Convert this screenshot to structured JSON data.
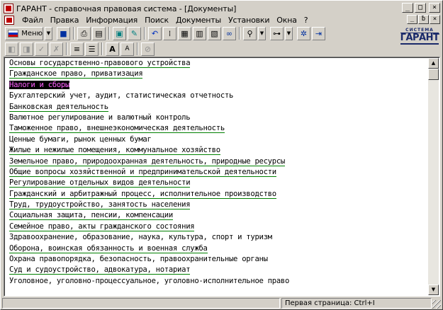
{
  "window": {
    "title": "ГАРАНТ - справочная правовая система - [Документы]",
    "caption_buttons": [
      "_",
      "□",
      "×"
    ]
  },
  "menubar": {
    "items": [
      "Файл",
      "Правка",
      "Информация",
      "Поиск",
      "Документы",
      "Установки",
      "Окна",
      "?"
    ],
    "mdi_buttons": [
      "_",
      "ƀ",
      "×"
    ]
  },
  "toolbar": {
    "menu_button_label": "Меню",
    "icons_row1": [
      "save-icon",
      "print-icon",
      "print-preview-icon",
      "copy-icon",
      "edit-icon",
      "back-icon",
      "split-icon",
      "document-icon",
      "document-list-icon",
      "document-view-icon",
      "binoculars-icon",
      "search-icon",
      "filter-icon",
      "globe-icon",
      "exit-icon"
    ],
    "icons_row2": [
      "prev-page-icon",
      "next-page-icon",
      "mark-icon",
      "unmark-icon",
      "bookmark-icon",
      "comment-icon",
      "font-increase-icon",
      "font-decrease-icon",
      "cancel-icon"
    ]
  },
  "logo": {
    "top": "СИСТЕМА",
    "main": "ГАРАНТ"
  },
  "documents": [
    {
      "text": "Основы государственно-правового устройства",
      "link": true
    },
    {
      "text": "Гражданское право, приватизация",
      "link": true
    },
    {
      "text": "Налоги и сборы",
      "link": true,
      "selected": true
    },
    {
      "text": "Бухгалтерский учет, аудит, статистическая отчетность",
      "link": false
    },
    {
      "text": "Банковская деятельность",
      "link": true
    },
    {
      "text": "Валютное регулирование и валютный контроль",
      "link": false
    },
    {
      "text": "Таможенное право, внешнеэкономическая деятельность",
      "link": true
    },
    {
      "text": "Ценные бумаги, рынок ценных бумаг",
      "link": false
    },
    {
      "text": "Жилые и нежилые помещения, коммунальное хозяйство",
      "link": true
    },
    {
      "text": "Земельное право, природоохранная деятельность, природные ресурсы",
      "link": true
    },
    {
      "text": "Общие вопросы хозяйственной и предпринимательской деятельности",
      "link": true
    },
    {
      "text": "Регулирование отдельных видов деятельности",
      "link": true
    },
    {
      "text": "Гражданский и арбитражный процесс, исполнительное производство",
      "link": true
    },
    {
      "text": "Труд, трудоустройство, занятость населения",
      "link": true
    },
    {
      "text": "Социальная защита, пенсии, компенсации",
      "link": true
    },
    {
      "text": "Семейное право, акты гражданского состояния",
      "link": true
    },
    {
      "text": "Здравоохранение, образование, наука, культура, спорт и туризм",
      "link": false
    },
    {
      "text": "Оборона, воинская обязанность и военная служба",
      "link": true
    },
    {
      "text": "Охрана правопорядка, безопасность, правоохранительные органы",
      "link": false
    },
    {
      "text": "Суд и судоустройство, адвокатура, нотариат",
      "link": true
    },
    {
      "text": "Уголовное, уголовно-процессуальное, уголовно-исполнительное право",
      "link": false
    }
  ],
  "statusbar": {
    "pages": "Первая страница: Ctrl+I"
  },
  "colors": {
    "link_underline": "#008000",
    "selection_bg": "#000000",
    "selection_fg": "#ff60ff",
    "chrome": "#d4d0c8"
  }
}
